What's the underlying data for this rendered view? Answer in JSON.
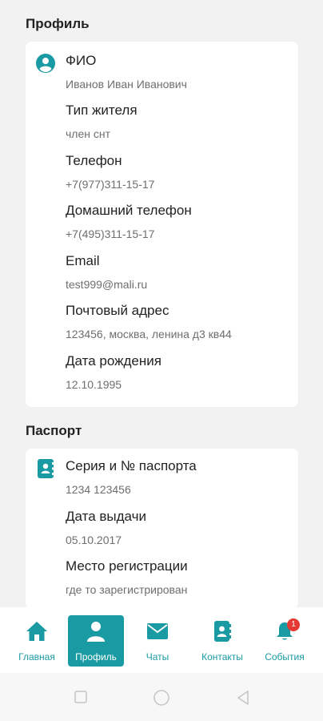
{
  "profile": {
    "section_title": "Профиль",
    "fields": [
      {
        "label": "ФИО",
        "value": "Иванов Иван Иванович"
      },
      {
        "label": "Тип жителя",
        "value": "член снт"
      },
      {
        "label": "Телефон",
        "value": "+7(977)311-15-17"
      },
      {
        "label": "Домашний телефон",
        "value": "+7(495)311-15-17"
      },
      {
        "label": "Email",
        "value": "test999@mali.ru"
      },
      {
        "label": "Почтовый адрес",
        "value": "123456, москва, ленина д3 кв44"
      },
      {
        "label": "Дата рождения",
        "value": "12.10.1995"
      }
    ]
  },
  "passport": {
    "section_title": "Паспорт",
    "fields": [
      {
        "label": "Серия и № паспорта",
        "value": "1234 123456"
      },
      {
        "label": "Дата выдачи",
        "value": "05.10.2017"
      },
      {
        "label": "Место регистрации",
        "value": "где то зарегистрирован"
      }
    ]
  },
  "tabbar": {
    "tabs": [
      {
        "label": "Главная",
        "icon": "home-icon",
        "active": false
      },
      {
        "label": "Профиль",
        "icon": "person-icon",
        "active": true
      },
      {
        "label": "Чаты",
        "icon": "envelope-icon",
        "active": false
      },
      {
        "label": "Контакты",
        "icon": "contacts-icon",
        "active": false
      },
      {
        "label": "События",
        "icon": "bell-icon",
        "active": false,
        "badge": "1"
      }
    ]
  },
  "colors": {
    "accent": "#1a9aa3",
    "badge": "#e53935",
    "background": "#f2f2f2"
  }
}
